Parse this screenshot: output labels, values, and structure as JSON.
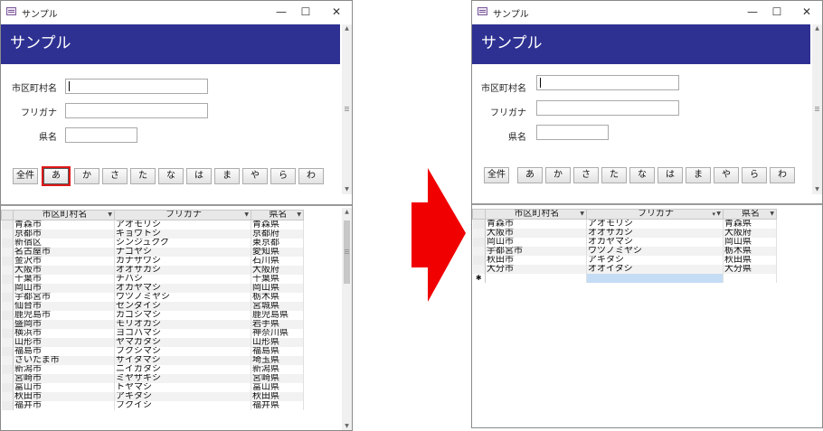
{
  "window": {
    "title": "サンプル",
    "minimize": "—",
    "maximize": "☐",
    "close": "✕"
  },
  "form": {
    "heading": "サンプル",
    "labels": {
      "city": "市区町村名",
      "kana": "フリガナ",
      "pref": "県名"
    },
    "buttons": [
      "全件",
      "あ",
      "か",
      "さ",
      "た",
      "な",
      "は",
      "ま",
      "や",
      "ら",
      "わ"
    ]
  },
  "grid": {
    "columns": [
      "市区町村名",
      "フリガナ",
      "県名"
    ]
  },
  "left": {
    "selected_button": "あ",
    "rows": [
      [
        "青森市",
        "アオモリシ",
        "青森県"
      ],
      [
        "京都市",
        "キョウトシ",
        "京都府"
      ],
      [
        "新宿区",
        "シンジュクク",
        "東京都"
      ],
      [
        "名古屋市",
        "ナゴヤシ",
        "愛知県"
      ],
      [
        "金沢市",
        "カナザワシ",
        "石川県"
      ],
      [
        "大阪市",
        "オオサカシ",
        "大阪府"
      ],
      [
        "千葉市",
        "チバシ",
        "千葉県"
      ],
      [
        "岡山市",
        "オカヤマシ",
        "岡山県"
      ],
      [
        "宇都宮市",
        "ウツノミヤシ",
        "栃木県"
      ],
      [
        "仙台市",
        "センダイシ",
        "宮城県"
      ],
      [
        "鹿児島市",
        "カゴシマシ",
        "鹿児島県"
      ],
      [
        "盛岡市",
        "モリオカシ",
        "岩手県"
      ],
      [
        "横浜市",
        "ヨコハマシ",
        "神奈川県"
      ],
      [
        "山形市",
        "ヤマガタシ",
        "山形県"
      ],
      [
        "福島市",
        "フクシマシ",
        "福島県"
      ],
      [
        "さいたま市",
        "サイタマシ",
        "埼玉県"
      ],
      [
        "新潟市",
        "ニイガタシ",
        "新潟県"
      ],
      [
        "宮崎市",
        "ミヤザキシ",
        "宮崎県"
      ],
      [
        "富山市",
        "トヤマシ",
        "富山県"
      ],
      [
        "秋田市",
        "アキタシ",
        "秋田県"
      ],
      [
        "福井市",
        "フクイシ",
        "福井県"
      ]
    ]
  },
  "right": {
    "new_record_marker": "✱",
    "filter_icon": "▾",
    "rows": [
      [
        "青森市",
        "アオモリシ",
        "青森県"
      ],
      [
        "大阪市",
        "オオサカシ",
        "大阪府"
      ],
      [
        "岡山市",
        "オカヤマシ",
        "岡山県"
      ],
      [
        "宇都宮市",
        "ウツノミヤシ",
        "栃木県"
      ],
      [
        "秋田市",
        "アキタシ",
        "秋田県"
      ],
      [
        "大分市",
        "オオイタシ",
        "大分県"
      ]
    ]
  },
  "colors": {
    "banner": "#2e3192",
    "arrow": "#f00000",
    "selected_outline": "#e01818",
    "new_row_highlight": "#c5dcf5"
  }
}
